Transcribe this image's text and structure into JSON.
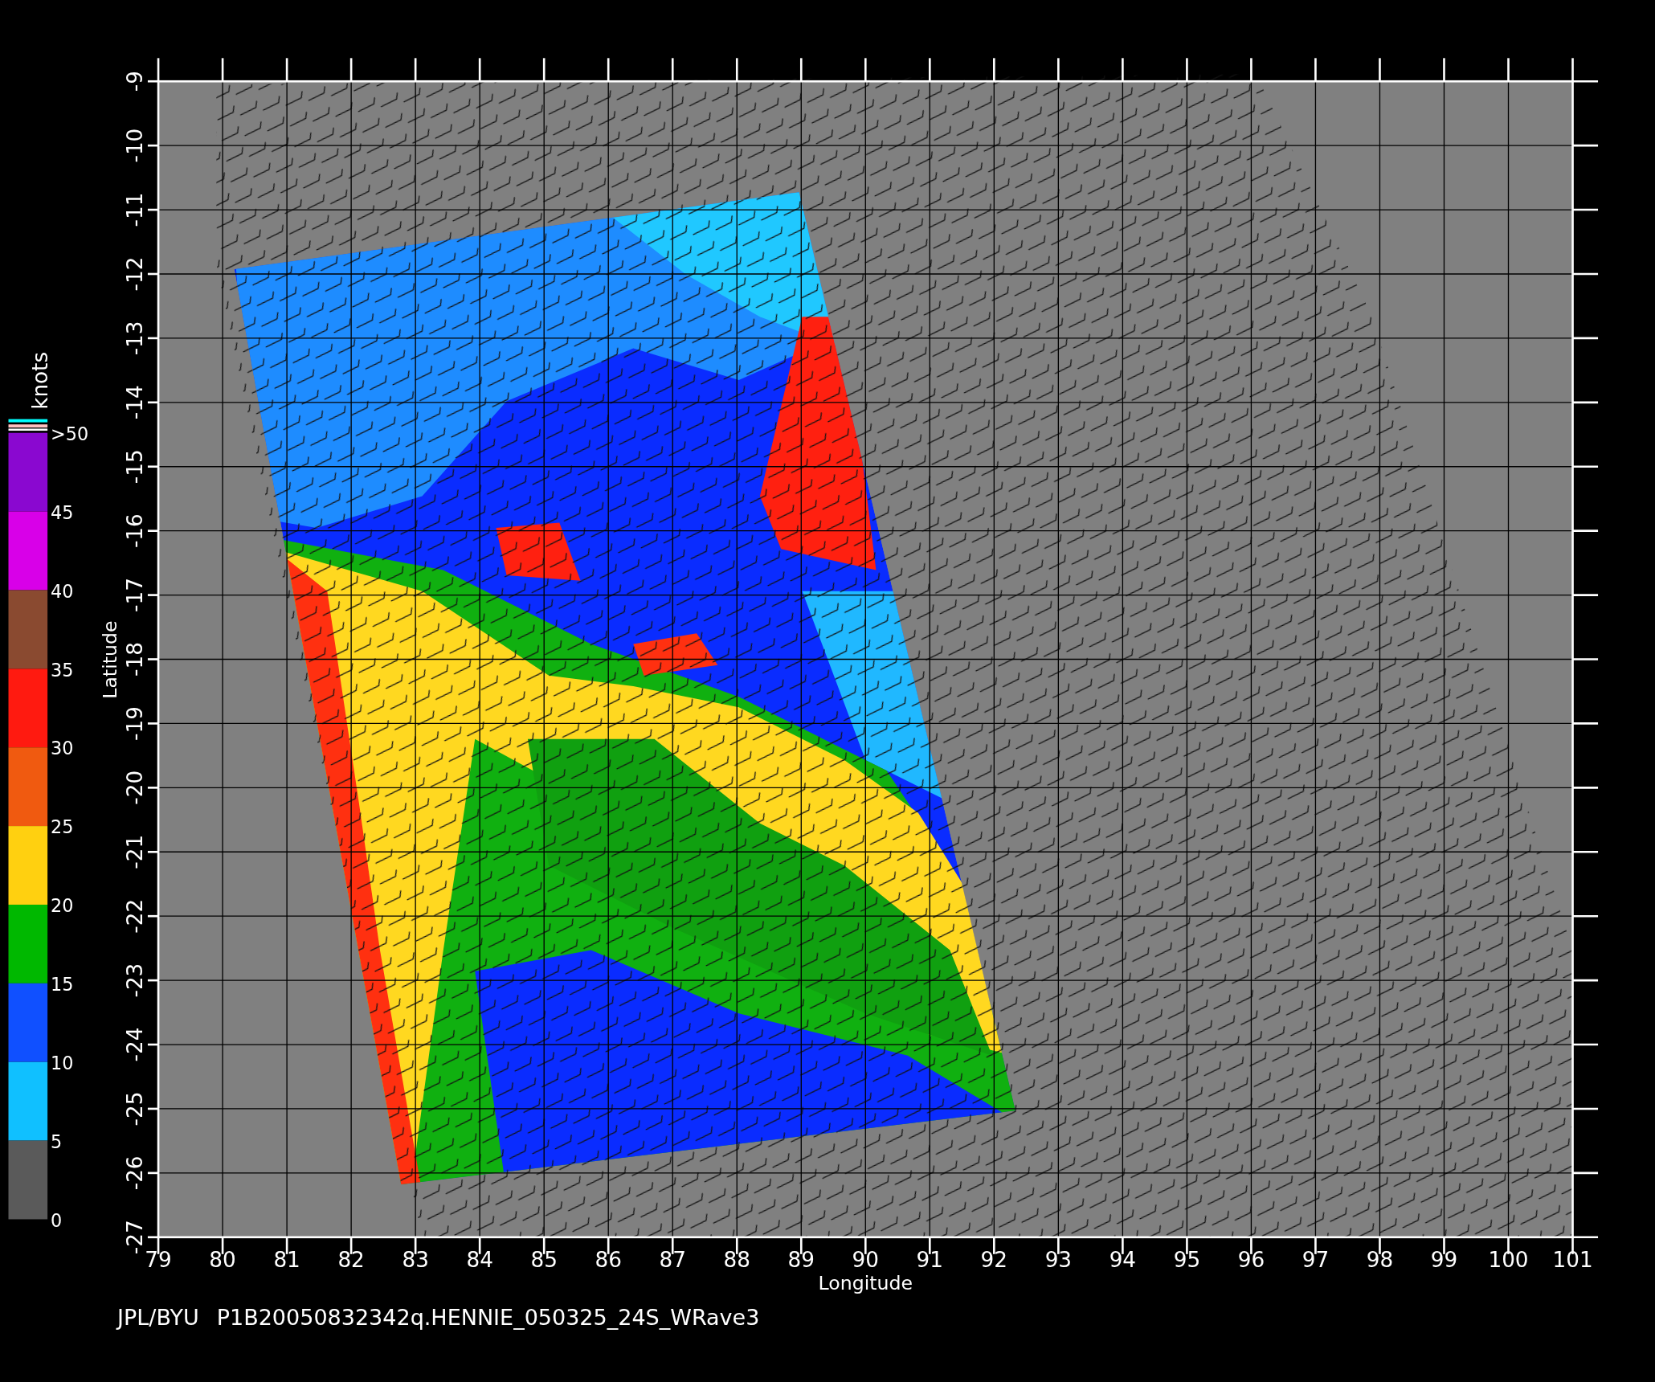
{
  "plot": {
    "xlabel": "Longitude",
    "ylabel": "Latitude",
    "xticks": [
      "79",
      "80",
      "81",
      "82",
      "83",
      "84",
      "85",
      "86",
      "87",
      "88",
      "89",
      "90",
      "91",
      "92",
      "93",
      "94",
      "95",
      "96",
      "97",
      "98",
      "99",
      "100",
      "101"
    ],
    "yticks": [
      "-9",
      "-10",
      "-11",
      "-12",
      "-13",
      "-14",
      "-15",
      "-16",
      "-17",
      "-18",
      "-19",
      "-20",
      "-21",
      "-22",
      "-23",
      "-24",
      "-25",
      "-26",
      "-27"
    ]
  },
  "legend": {
    "title": "knots",
    "labels": [
      ">50",
      "45",
      "40",
      "35",
      "30",
      "25",
      "20",
      "15",
      "10",
      "5",
      "0"
    ],
    "bands": [
      {
        "color": "#8a08d0"
      },
      {
        "color": "#d800e8"
      },
      {
        "color": "#8a4a30"
      },
      {
        "color": "#ff1a10"
      },
      {
        "color": "#f05a10"
      },
      {
        "color": "#ffd010"
      },
      {
        "color": "#00b800"
      },
      {
        "color": "#1050ff"
      },
      {
        "color": "#10c0ff"
      },
      {
        "color": "#5a5a5a"
      }
    ]
  },
  "footer": [
    "JPL/BYU",
    "P1B20050832342q.HENNIE_050325_24S_WRave3"
  ]
}
